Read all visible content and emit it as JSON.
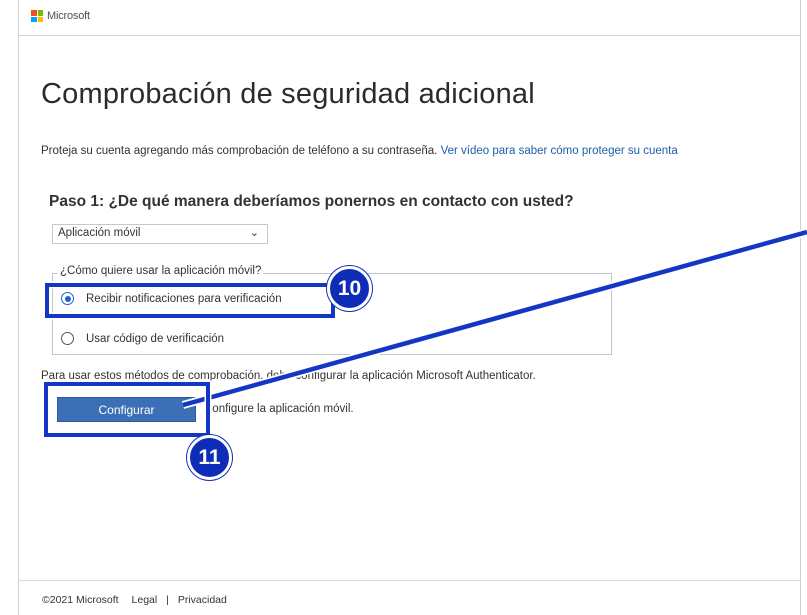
{
  "header": {
    "brand": "Microsoft"
  },
  "page": {
    "title": "Comprobación de seguridad adicional",
    "intro_text": "Proteja su cuenta agregando más comprobación de teléfono a su contraseña. ",
    "intro_link": "Ver vídeo para saber cómo proteger su cuenta"
  },
  "step1": {
    "heading": "Paso 1: ¿De qué manera deberíamos ponernos en contacto con usted?",
    "method_selected": "Aplicación móvil",
    "usage_legend": "¿Cómo quiere usar la aplicación móvil?",
    "options": [
      {
        "label": "Recibir notificaciones para verificación",
        "checked": true
      },
      {
        "label": "Usar código de verificación",
        "checked": false
      }
    ],
    "info_text": "Para usar estos métodos de comprobación, debe configurar la aplicación Microsoft Authenticator.",
    "configure_label": "Configurar",
    "configure_hint": "Configure la aplicación móvil."
  },
  "footer": {
    "copyright": "©2021 Microsoft",
    "legal": "Legal",
    "separator": "|",
    "privacy": "Privacidad"
  },
  "annotations": {
    "callout_1": "10",
    "callout_2": "11",
    "highlight_color": "#1436c4"
  },
  "colors": {
    "accent": "#3c6fb5",
    "link": "#1a5fa8",
    "logo": [
      "#f25022",
      "#7fba00",
      "#00a4ef",
      "#ffb900"
    ]
  },
  "icons": {
    "dropdown": "chevron-down-icon",
    "logo": "microsoft-logo-icon"
  }
}
